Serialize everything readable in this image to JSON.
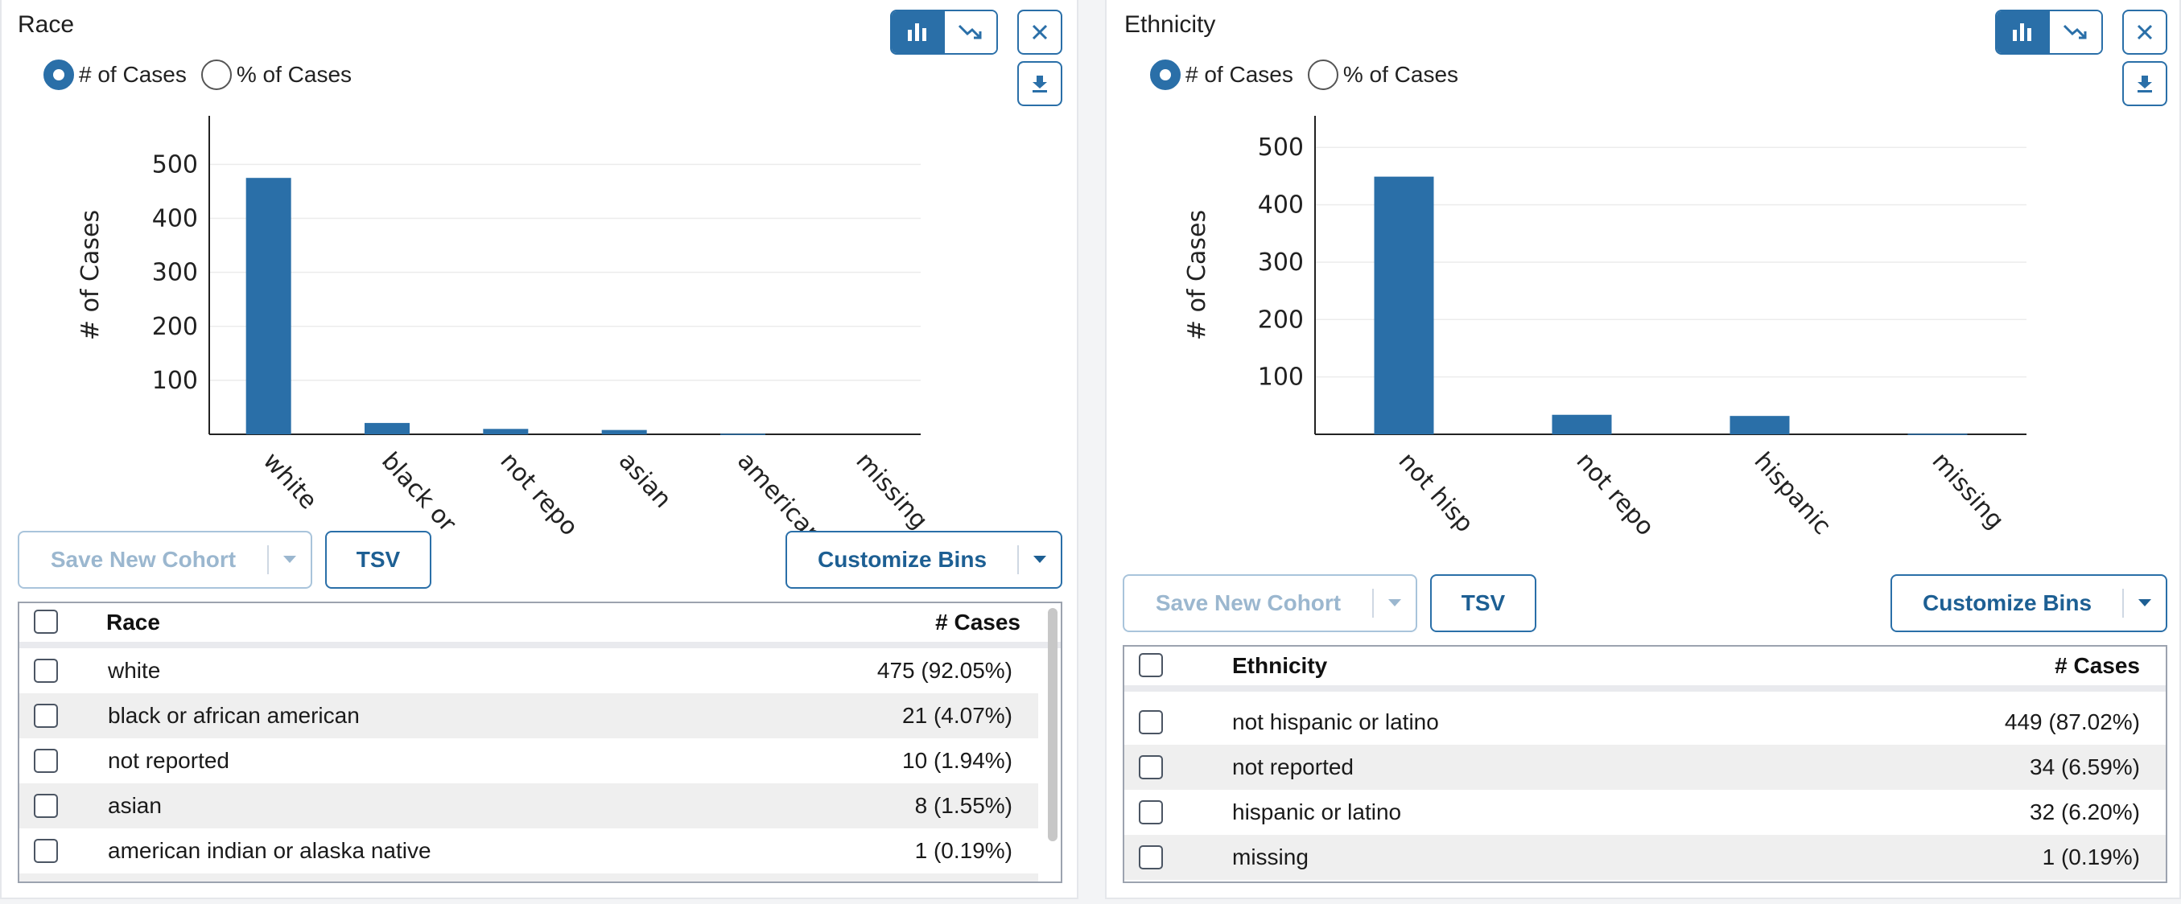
{
  "colors": {
    "accent": "#2a6fa8",
    "bar": "#2a6fa8"
  },
  "race": {
    "title": "Race",
    "radio_count_label": "# of Cases",
    "radio_percent_label": "% of Cases",
    "save_cohort_label": "Save New Cohort",
    "tsv_label": "TSV",
    "customize_bins_label": "Customize Bins",
    "table": {
      "col_name": "Race",
      "col_count": "# Cases",
      "rows": [
        {
          "name": "white",
          "count": "475 (92.05%)"
        },
        {
          "name": "black or african american",
          "count": "21 (4.07%)"
        },
        {
          "name": "not reported",
          "count": "10 (1.94%)"
        },
        {
          "name": "asian",
          "count": "8 (1.55%)"
        },
        {
          "name": "american indian or alaska native",
          "count": "1 (0.19%)"
        }
      ]
    }
  },
  "ethnicity": {
    "title": "Ethnicity",
    "radio_count_label": "# of Cases",
    "radio_percent_label": "% of Cases",
    "save_cohort_label": "Save New Cohort",
    "tsv_label": "TSV",
    "customize_bins_label": "Customize Bins",
    "table": {
      "col_name": "Ethnicity",
      "col_count": "# Cases",
      "rows": [
        {
          "name": "not hispanic or latino",
          "count": "449 (87.02%)"
        },
        {
          "name": "not reported",
          "count": "34 (6.59%)"
        },
        {
          "name": "hispanic or latino",
          "count": "32 (6.20%)"
        },
        {
          "name": "missing",
          "count": "1 (0.19%)"
        }
      ]
    }
  },
  "chart_data": [
    {
      "type": "bar",
      "ylabel": "# of Cases",
      "categories": [
        "white",
        "black or",
        "not repo",
        "asian",
        "american",
        "missing"
      ],
      "values": [
        475,
        21,
        10,
        8,
        1,
        0
      ],
      "yticks": [
        100,
        200,
        300,
        400,
        500
      ],
      "ylim": [
        0,
        590
      ],
      "grid": true
    },
    {
      "type": "bar",
      "ylabel": "# of Cases",
      "categories": [
        "not hisp",
        "not repo",
        "hispanic",
        "missing"
      ],
      "values": [
        449,
        34,
        32,
        1
      ],
      "yticks": [
        100,
        200,
        300,
        400,
        500
      ],
      "ylim": [
        0,
        555
      ],
      "grid": true
    }
  ]
}
